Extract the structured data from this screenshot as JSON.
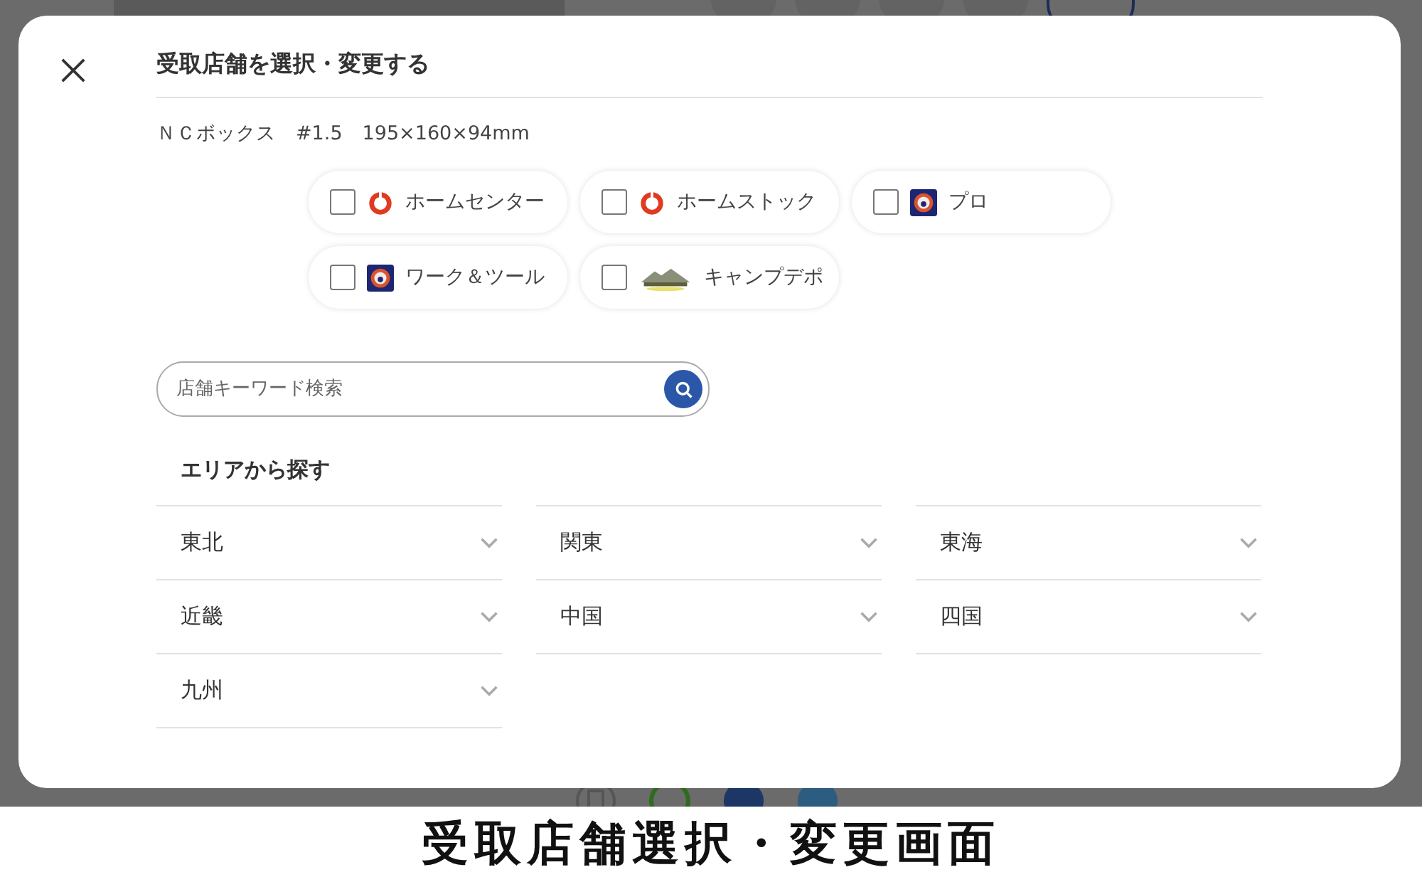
{
  "modal": {
    "title": "受取店舗を選択・変更する",
    "product": "ＮＣボックス　#1.5　195×160×94mm",
    "stores": [
      {
        "label": "ホームセンター",
        "checked": false,
        "kind": "ring"
      },
      {
        "label": "ホームストック",
        "checked": false,
        "kind": "ring"
      },
      {
        "label": "プロ",
        "checked": false,
        "kind": "badge"
      },
      {
        "label": "ワーク＆ツール",
        "checked": false,
        "kind": "badge"
      },
      {
        "label": "キャンプデポ",
        "checked": false,
        "kind": "mountain"
      }
    ],
    "search": {
      "placeholder": "店舗キーワード検索"
    },
    "area_heading": "エリアから探す",
    "areas": [
      {
        "label": "東北",
        "expanded": false
      },
      {
        "label": "関東",
        "expanded": false
      },
      {
        "label": "東海",
        "expanded": false
      },
      {
        "label": "近畿",
        "expanded": false
      },
      {
        "label": "中国",
        "expanded": false
      },
      {
        "label": "四国",
        "expanded": false
      },
      {
        "label": "九州",
        "expanded": false
      }
    ]
  },
  "caption": "受取店舗選択・変更画面"
}
